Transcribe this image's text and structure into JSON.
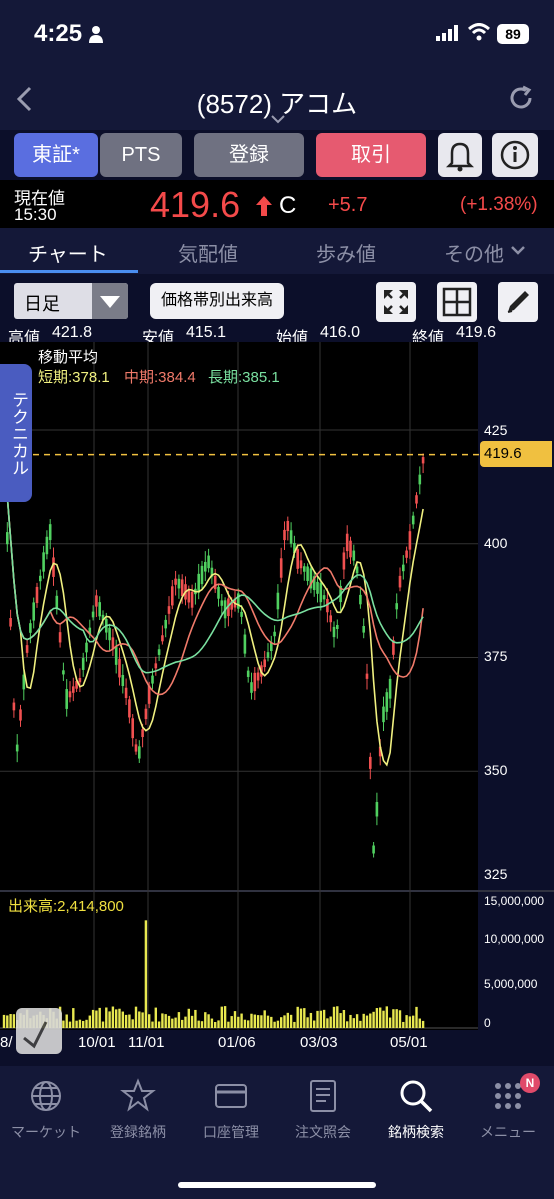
{
  "status_bar": {
    "time": "4:25",
    "battery": "89"
  },
  "header": {
    "title": "(8572) アコム"
  },
  "actions": {
    "tse": "東証*",
    "pts": "PTS",
    "register": "登録",
    "trade": "取引"
  },
  "quote": {
    "label": "現在値",
    "time": "15:30",
    "price": "419.6",
    "flag": "C",
    "change": "+5.7",
    "change_pct": "(+1.38%)"
  },
  "tabs": [
    {
      "label": "チャート",
      "active": true
    },
    {
      "label": "気配値",
      "active": false
    },
    {
      "label": "歩み値",
      "active": false
    },
    {
      "label": "その他",
      "active": false
    }
  ],
  "toolbar": {
    "period": "日足",
    "volume_profile": "価格帯別出来高"
  },
  "ohlc": {
    "high_label": "高値",
    "high": "421.8",
    "low_label": "安値",
    "low": "415.1",
    "open_label": "始値",
    "open": "416.0",
    "close_label": "終値",
    "close": "419.6"
  },
  "technical_tab": "テクニカル",
  "moving_average": {
    "title": "移動平均",
    "short": "短期:378.1",
    "mid": "中期:384.4",
    "long": "長期:385.1",
    "short_color": "#f0f080",
    "mid_color": "#f07a6a",
    "long_color": "#7ae0a0"
  },
  "last_price_tag": "419.6",
  "volume": {
    "label": "出来高:2,414,800"
  },
  "chart_data": {
    "type": "candlestick",
    "price_axis": {
      "ticks": [
        "425",
        "400",
        "375",
        "350",
        "325"
      ],
      "range": [
        322,
        433
      ]
    },
    "volume_axis": {
      "ticks": [
        "15,000,000",
        "10,000,000",
        "5,000,000",
        "0"
      ],
      "range": [
        0,
        15000000
      ]
    },
    "date_labels": [
      "8/",
      "10/01",
      "11/01",
      "01/06",
      "03/03",
      "05/01"
    ],
    "last_price": 419.6,
    "ma_short_last": 378.1,
    "ma_mid_last": 384.4,
    "ma_long_last": 385.1,
    "colors": {
      "up": "#f05050",
      "down": "#50d060",
      "ma_short": "#f0f080",
      "ma_mid": "#f07a6a",
      "ma_long": "#7ae0a0",
      "volume": "#e8e850"
    }
  },
  "bottom_nav": [
    {
      "label": "マーケット",
      "icon": "globe-icon",
      "active": false
    },
    {
      "label": "登録銘柄",
      "icon": "star-icon",
      "active": false
    },
    {
      "label": "口座管理",
      "icon": "card-icon",
      "active": false
    },
    {
      "label": "注文照会",
      "icon": "document-icon",
      "active": false
    },
    {
      "label": "銘柄検索",
      "icon": "search-icon",
      "active": true
    },
    {
      "label": "メニュー",
      "icon": "menu-grid-icon",
      "active": false
    }
  ],
  "menu_badge": "N"
}
